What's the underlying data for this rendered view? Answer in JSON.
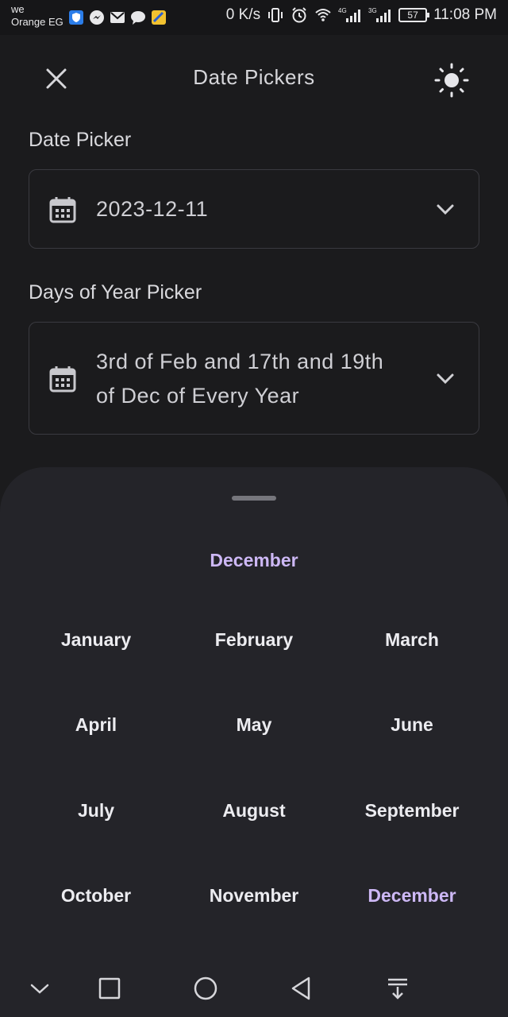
{
  "status_bar": {
    "carrier_line1": "we",
    "carrier_line2": "Orange EG",
    "network_speed": "0 K/s",
    "battery": "57",
    "time": "11:08 PM",
    "signal_label_1": "4G",
    "signal_label_2": "3G"
  },
  "app_bar": {
    "title": "Date Pickers"
  },
  "date_picker": {
    "label": "Date Picker",
    "value": "2023-12-11"
  },
  "days_of_year_picker": {
    "label": "Days of Year Picker",
    "value_line1": "3rd of Feb and 17th and 19th",
    "value_line2": "of Dec of Every Year"
  },
  "month_sheet": {
    "title": "December",
    "months": [
      "January",
      "February",
      "March",
      "April",
      "May",
      "June",
      "July",
      "August",
      "September",
      "October",
      "November",
      "December"
    ],
    "selected": "December",
    "accent_color": "#cdb8f5"
  }
}
